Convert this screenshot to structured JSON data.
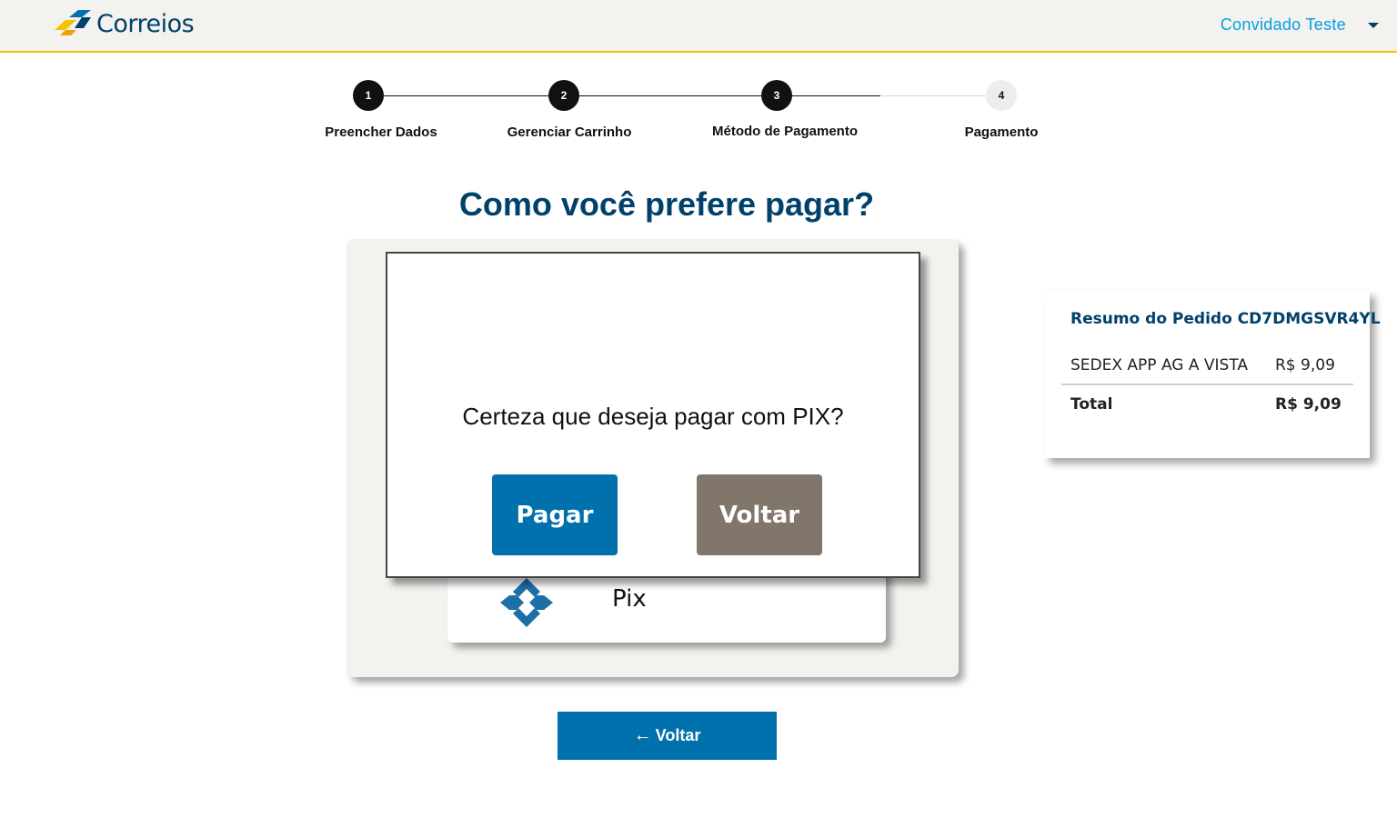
{
  "header": {
    "brand": "Correios",
    "user_name": "Convidado Teste"
  },
  "stepper": {
    "steps": [
      {
        "number": "1",
        "label": "Preencher Dados",
        "status": "done"
      },
      {
        "number": "2",
        "label": "Gerenciar Carrinho",
        "status": "done"
      },
      {
        "number": "3",
        "label": "Método de Pagamento",
        "status": "current"
      },
      {
        "number": "4",
        "label": "Pagamento",
        "status": "todo"
      }
    ]
  },
  "main": {
    "title": "Como você prefere pagar?",
    "payment_option_label": "Pix",
    "back_button": "Voltar"
  },
  "modal": {
    "question": "Certeza que deseja pagar com PIX?",
    "confirm_label": "Pagar",
    "cancel_label": "Voltar"
  },
  "summary": {
    "title": "Resumo do Pedido CD7DMGSVR4YL",
    "item_name": "SEDEX APP AG A VISTA",
    "item_value": "R$ 9,09",
    "total_label": "Total",
    "total_value": "R$ 9,09"
  },
  "colors": {
    "primary_blue": "#0071ad",
    "title_blue": "#00416b",
    "link_blue": "#00a0e3",
    "accent_yellow": "#f5c400",
    "secondary_button": "#81766a"
  }
}
